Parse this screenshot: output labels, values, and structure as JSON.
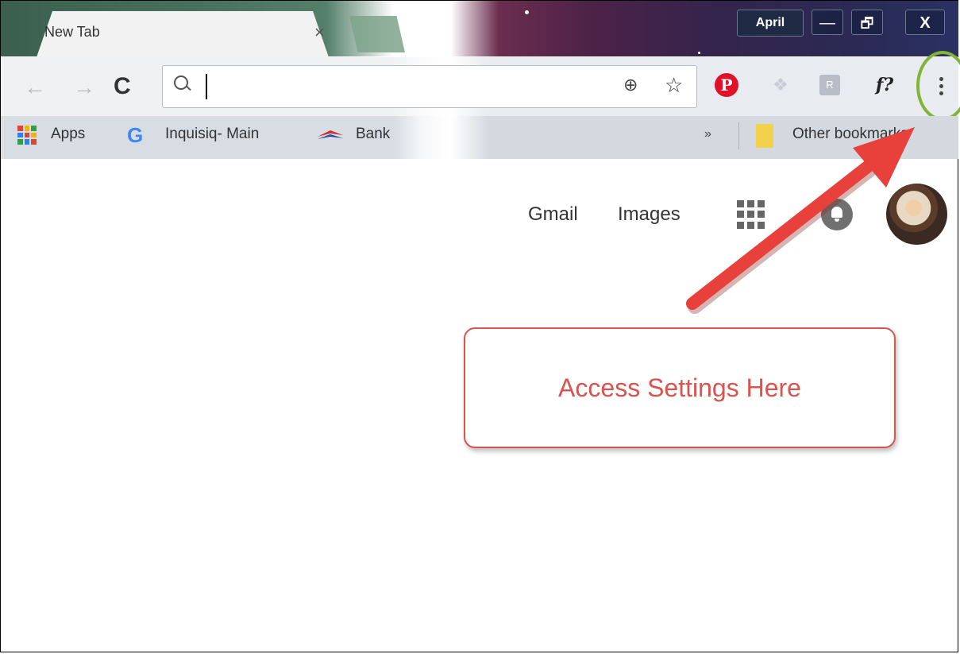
{
  "tab": {
    "title": "New Tab",
    "close": "×"
  },
  "window": {
    "profile": "April",
    "minimize": "—",
    "restore": "🗗",
    "close": "X"
  },
  "toolbar": {
    "back": "←",
    "forward": "→",
    "reload": "C",
    "omnibox_value": "",
    "zoom": "⊕",
    "bookmark_star": "☆",
    "extensions": {
      "pinterest": "P",
      "dropbox": "❖",
      "rk": "R",
      "fq": "f?"
    }
  },
  "bookmarks": {
    "apps": "Apps",
    "inquisiq": "Inquisiq- Main",
    "bank": "Bank",
    "overflow": "»",
    "other": "Other bookmarks"
  },
  "page": {
    "gmail": "Gmail",
    "images": "Images"
  },
  "callout": {
    "text": "Access Settings Here"
  },
  "colors": {
    "callout_red": "#d9534f",
    "ring_green": "#82b536",
    "arrow_red": "#e8413c"
  },
  "icons": [
    "search-icon",
    "zoom-icon",
    "star-icon",
    "pinterest-icon",
    "dropbox-icon",
    "apps-grid-icon",
    "google-icon",
    "bank-icon",
    "folder-icon",
    "menu-dots-icon",
    "bell-icon"
  ]
}
